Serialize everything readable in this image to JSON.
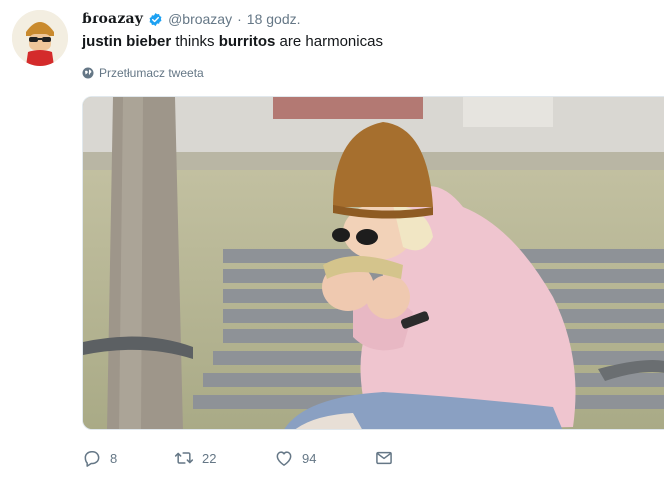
{
  "tweet": {
    "display_name": "ɓɾoazay",
    "handle": "@broazay",
    "separator": "·",
    "time": "18 godz.",
    "text_parts": {
      "name_bold": "justin bieber",
      "mid1": " thinks ",
      "food_bold": "burritos",
      "end": " are harmonicas"
    },
    "translate_label": "Przetłumacz tweeta",
    "actions": {
      "reply_count": "8",
      "retweet_count": "22",
      "like_count": "94"
    }
  },
  "icons": {
    "verified": "verified-badge-icon",
    "translate": "globe-icon",
    "reply": "reply-icon",
    "retweet": "retweet-icon",
    "like": "heart-icon",
    "dm": "envelope-icon"
  },
  "colors": {
    "text": "#14171a",
    "muted": "#657786",
    "verified": "#1da1f2"
  }
}
